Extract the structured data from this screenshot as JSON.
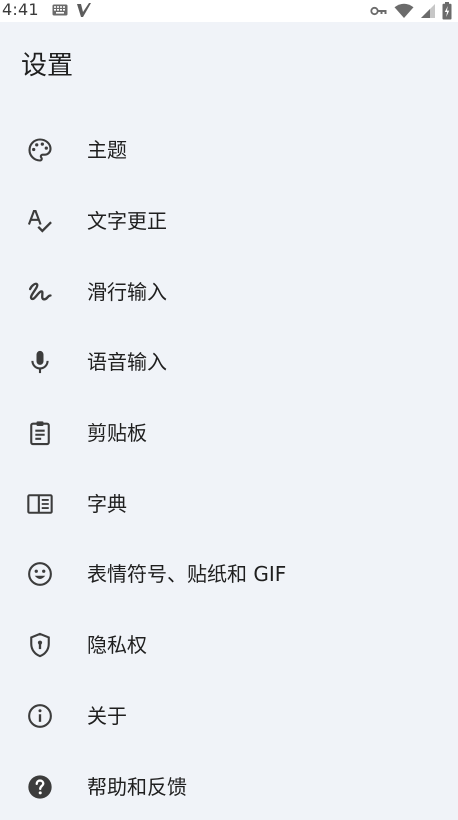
{
  "status_bar": {
    "time": "4:41",
    "icons": [
      "keyboard-icon",
      "v-logo-icon",
      "vpn-key-icon",
      "wifi-icon",
      "signal-icon",
      "battery-icon"
    ]
  },
  "header": {
    "title": "设置"
  },
  "menu": {
    "items": [
      {
        "label": "主题",
        "icon": "palette-icon"
      },
      {
        "label": "文字更正",
        "icon": "spellcheck-icon"
      },
      {
        "label": "滑行输入",
        "icon": "gesture-icon"
      },
      {
        "label": "语音输入",
        "icon": "microphone-icon"
      },
      {
        "label": "剪贴板",
        "icon": "clipboard-icon"
      },
      {
        "label": "字典",
        "icon": "dictionary-icon"
      },
      {
        "label": "表情符号、贴纸和 GIF",
        "icon": "emoji-icon"
      },
      {
        "label": "隐私权",
        "icon": "shield-icon"
      },
      {
        "label": "关于",
        "icon": "info-icon"
      },
      {
        "label": "帮助和反馈",
        "icon": "help-icon"
      }
    ]
  },
  "colors": {
    "background": "#f0f3f8",
    "status_bar": "#ffffff",
    "text": "#1f1f1f",
    "icon": "#3c3c3c"
  }
}
